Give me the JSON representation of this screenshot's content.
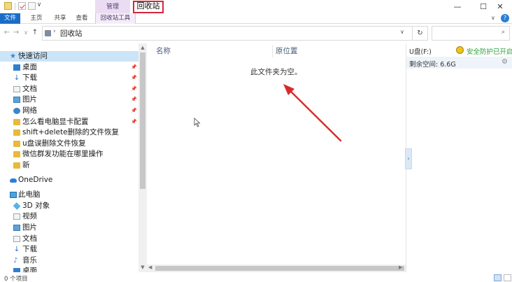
{
  "title_bar": {
    "title": "回收站",
    "contextual_group": "管理",
    "window_buttons": {
      "minimize": "—",
      "maximize": "☐",
      "close": "✕"
    },
    "quick_access_chevron": "∨"
  },
  "ribbon": {
    "tabs": [
      {
        "label": "文件",
        "active": true
      },
      {
        "label": "主页"
      },
      {
        "label": "共享"
      },
      {
        "label": "查看"
      },
      {
        "label": "回收站工具"
      }
    ],
    "collapse_chevron": "∨",
    "help": "?"
  },
  "address_bar": {
    "back": "←",
    "forward": "→",
    "history": "∨",
    "up": "↑",
    "separator": "›",
    "path": "回收站",
    "dropdown": "∨",
    "refresh": "↻",
    "search_placeholder": "",
    "search_glyph": "⌕"
  },
  "navigation": {
    "quick_access": "快速访问",
    "pinned": [
      {
        "label": "桌面",
        "icon": "desktop-icon",
        "pinned": true
      },
      {
        "label": "下载",
        "icon": "download-icon",
        "pinned": true
      },
      {
        "label": "文档",
        "icon": "document-icon",
        "pinned": true
      },
      {
        "label": "图片",
        "icon": "picture-icon",
        "pinned": true
      },
      {
        "label": "网络",
        "icon": "network-icon",
        "pinned": true
      },
      {
        "label": "怎么看电脑显卡配置",
        "icon": "folder-icon",
        "pinned": true
      },
      {
        "label": "shift+delete删除的文件恢复",
        "icon": "folder-icon"
      },
      {
        "label": "u盘误删除文件恢复",
        "icon": "folder-icon"
      },
      {
        "label": "微信群发功能在哪里操作",
        "icon": "folder-icon"
      },
      {
        "label": "新",
        "icon": "folder-icon"
      }
    ],
    "onedrive": "OneDrive",
    "this_pc": "此电脑",
    "pc_items": [
      {
        "label": "3D 对象",
        "icon": "3d-objects-icon"
      },
      {
        "label": "视频",
        "icon": "video-icon"
      },
      {
        "label": "图片",
        "icon": "picture-icon"
      },
      {
        "label": "文档",
        "icon": "document-icon"
      },
      {
        "label": "下载",
        "icon": "download-icon"
      },
      {
        "label": "音乐",
        "icon": "music-icon"
      },
      {
        "label": "桌面",
        "icon": "desktop-icon"
      }
    ],
    "pin_glyph": "📌",
    "scroll_up": "▲",
    "scroll_down": "▼"
  },
  "content": {
    "columns": [
      "名称",
      "原位置"
    ],
    "empty_message": "此文件夹为空。",
    "scroll_left": "◀",
    "scroll_right": "▶"
  },
  "details": {
    "drive": "U盘(F:)",
    "protection_status": "安全防护已开启",
    "free_space": "剩余空间: 6.6G",
    "expand": "›"
  },
  "status_bar": {
    "item_count": "0 个项目"
  },
  "colors": {
    "file_tab": "#1a6dc7",
    "manage_tab": "#eadcf3",
    "highlight_border": "#d6263c",
    "annotation_arrow": "#d62b2b",
    "selected_nav": "#cce4f7",
    "protection_text": "#2aa13a"
  }
}
